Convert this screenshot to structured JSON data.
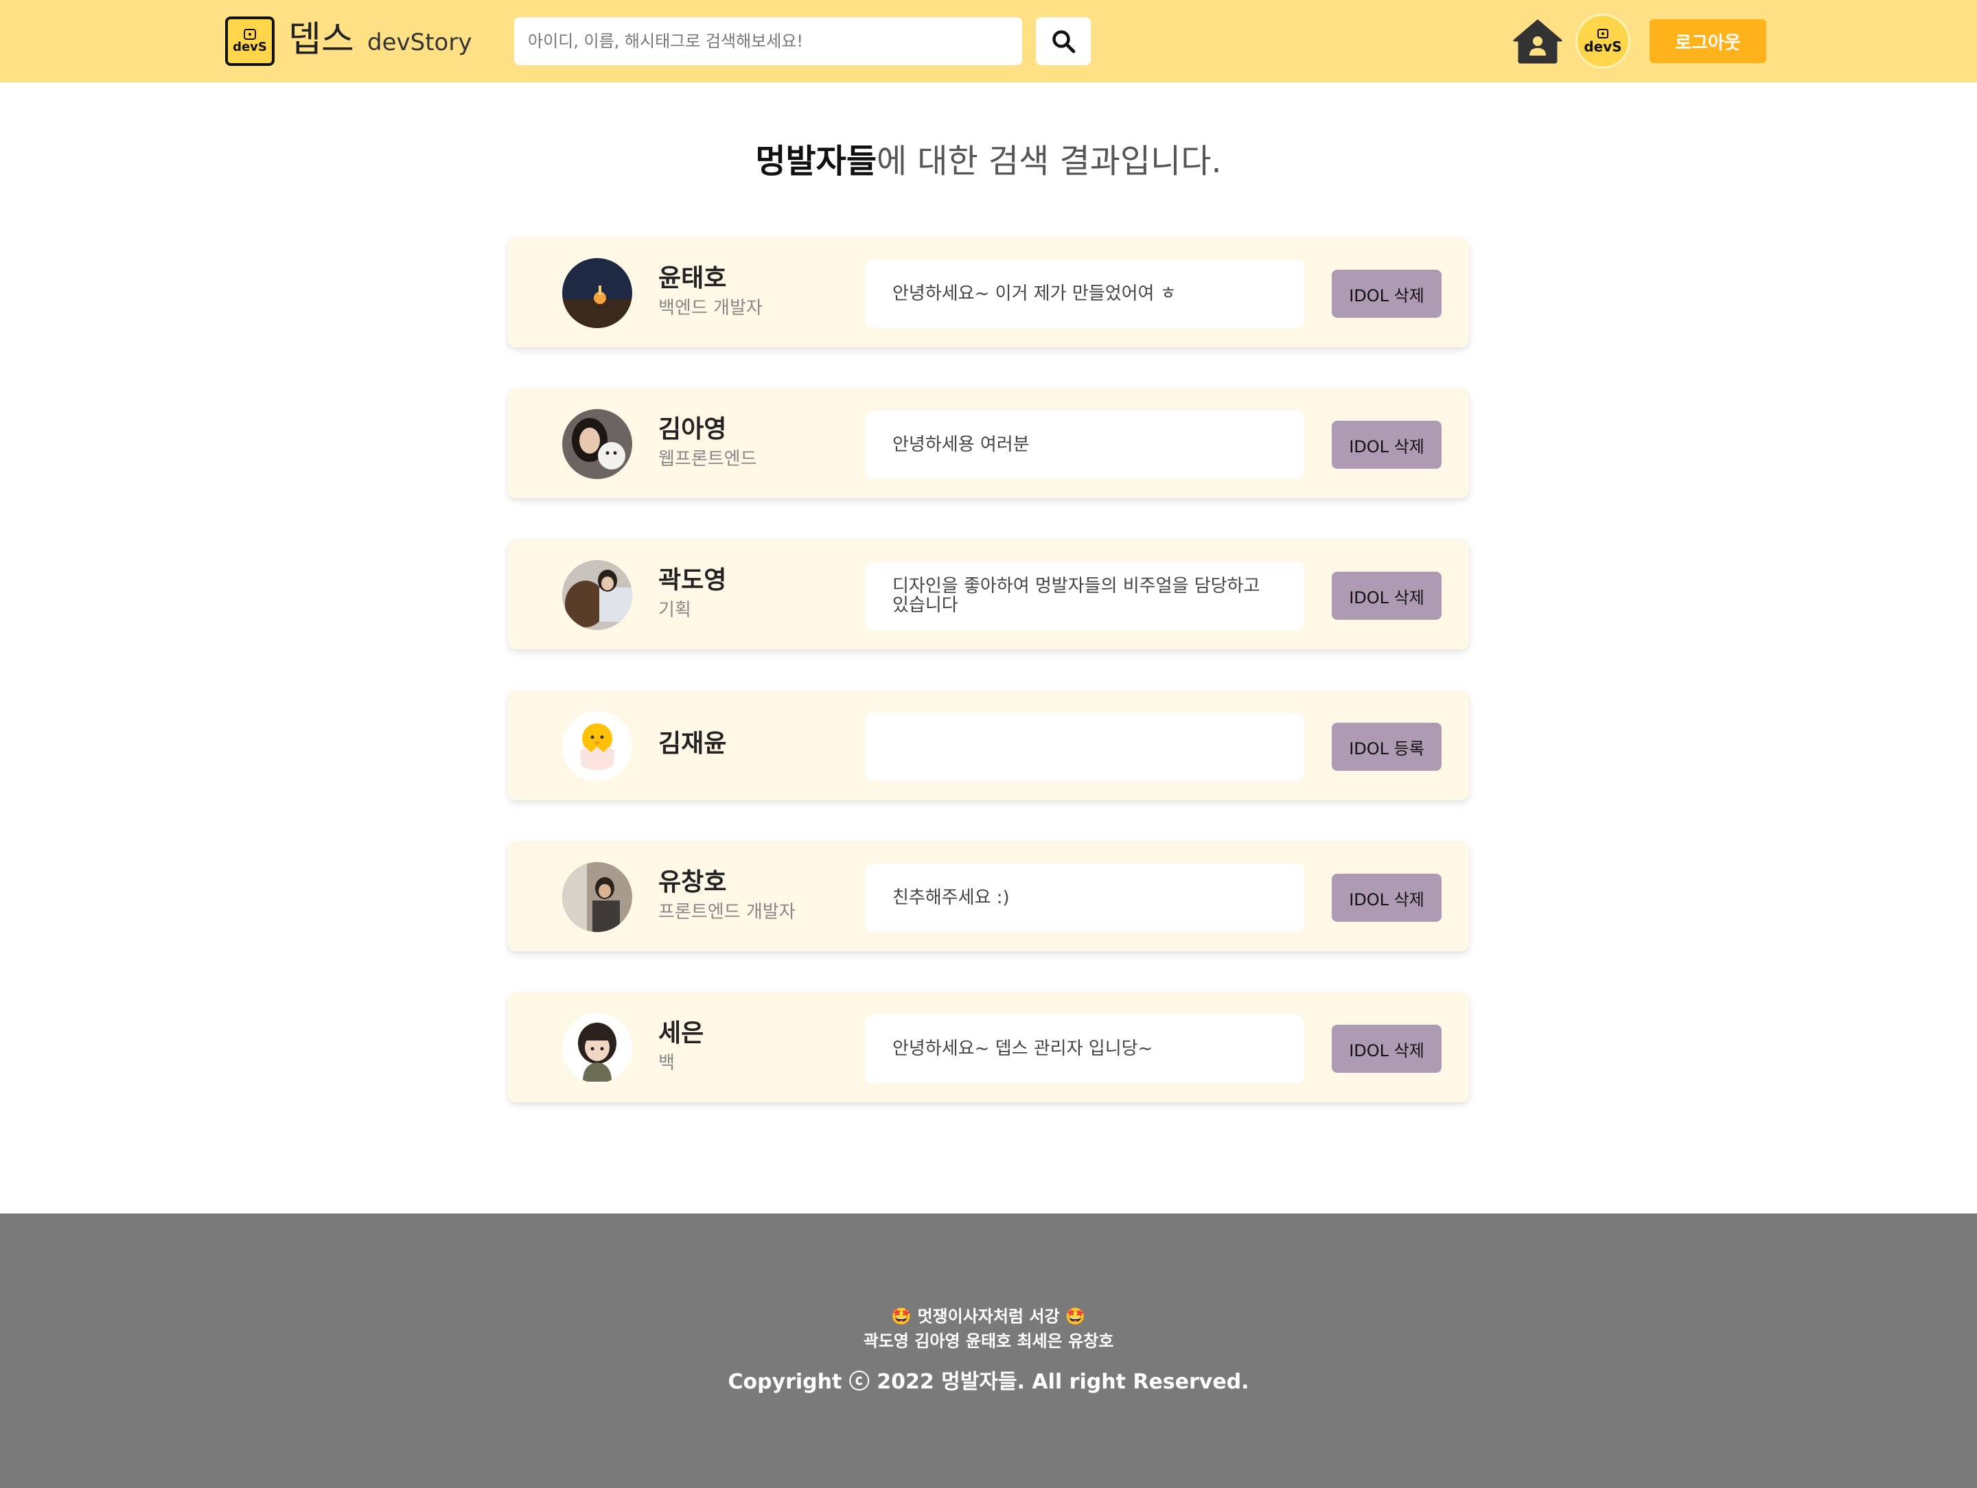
{
  "header": {
    "logo_text": "devS",
    "brand_kr": "뎁스",
    "brand_en": "devStory",
    "search_placeholder": "아이디, 이름, 해시태그로 검색해보세요!",
    "avatar_text": "devS",
    "logout_label": "로그아웃",
    "colors": {
      "background": "#ffe084",
      "logout": "#ffb21a",
      "logo": "#ffd54a"
    }
  },
  "main": {
    "keyword": "멍발자들",
    "title_suffix": "에 대한 검색 결과입니다."
  },
  "results": [
    {
      "name": "윤태호",
      "role": "백엔드 개발자",
      "intro": "안녕하세요~ 이거 제가 만들었어여 ㅎ",
      "button": "IDOL 삭제"
    },
    {
      "name": "김아영",
      "role": "웹프론트엔드",
      "intro": "안녕하세용 여러분",
      "button": "IDOL 삭제"
    },
    {
      "name": "곽도영",
      "role": "기획",
      "intro": "디자인을 좋아하여 멍발자들의 비주얼을 담당하고 있습니다",
      "button": "IDOL 삭제"
    },
    {
      "name": "김재윤",
      "role": "",
      "intro": "",
      "button": "IDOL 등록"
    },
    {
      "name": "유창호",
      "role": "프론트엔드 개발자",
      "intro": "친추해주세요 :)",
      "button": "IDOL 삭제"
    },
    {
      "name": "세은",
      "role": "백",
      "intro": "안녕하세요~ 뎁스 관리자 입니당~",
      "button": "IDOL 삭제"
    }
  ],
  "footer": {
    "slogan": "🤩 멋쟁이사자처럼 서강 🤩",
    "members": "곽도영 김아영 윤태호 최세은 유창호",
    "copyright": "Copyright ⓒ 2022 멍발자들. All right Reserved."
  },
  "colors": {
    "card": "#fff8e6",
    "idol_button": "#ae9bb3",
    "footer": "#7a7a7a"
  }
}
